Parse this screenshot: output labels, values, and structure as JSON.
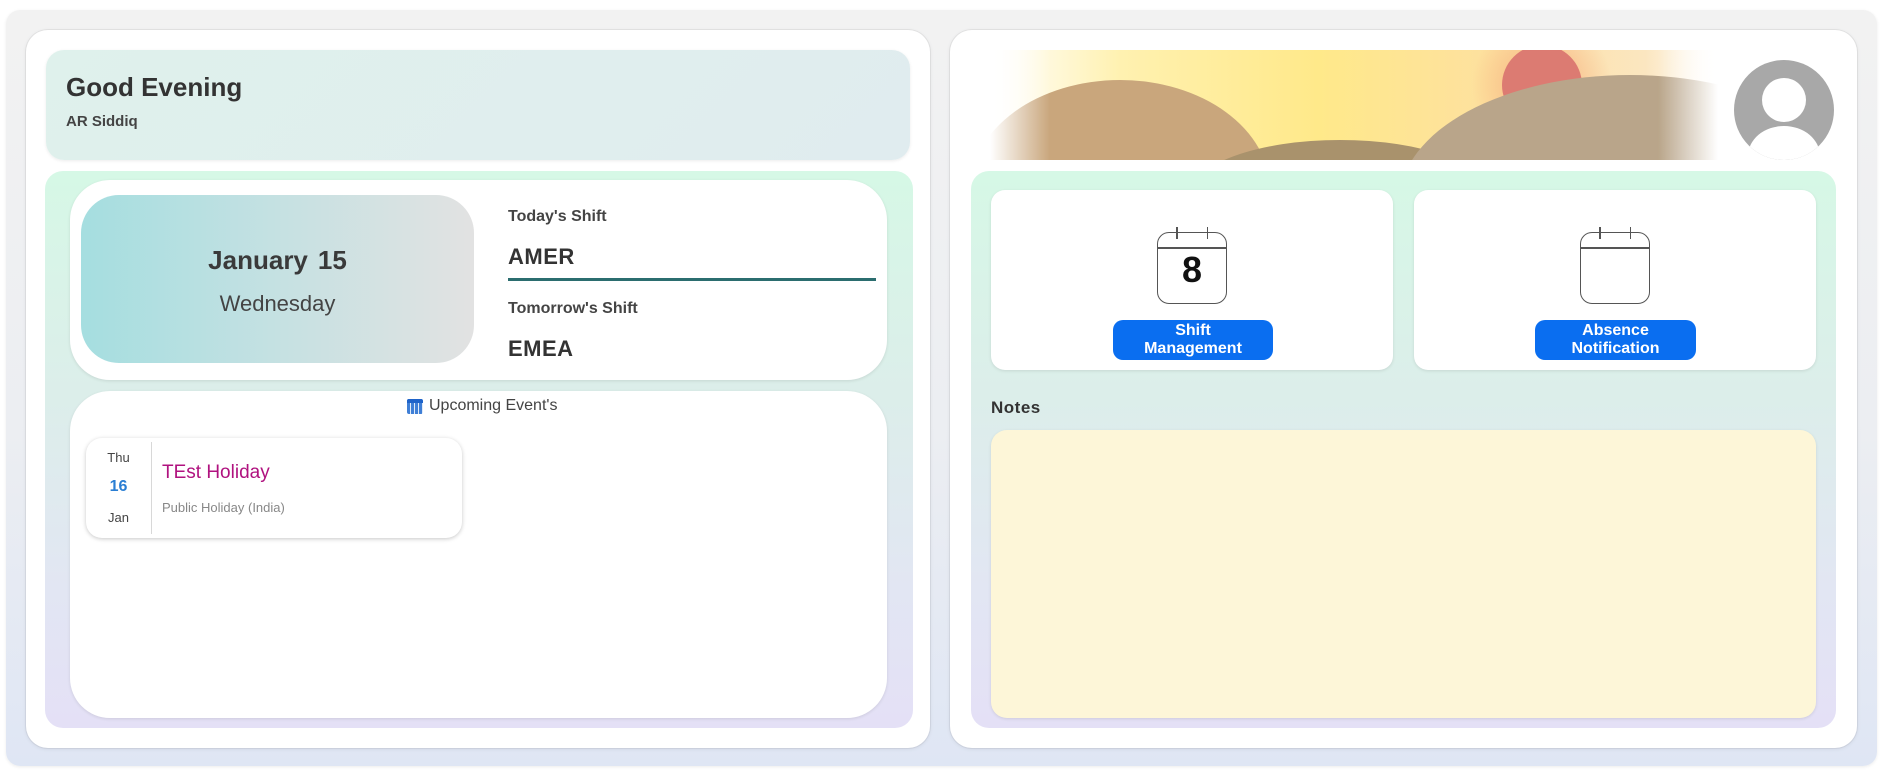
{
  "greeting": {
    "title": "Good Evening",
    "user": "AR Siddiq"
  },
  "today": {
    "month": "January",
    "day": "15",
    "weekday": "Wednesday"
  },
  "shifts": {
    "today_label": "Today's Shift",
    "today_value": "AMER",
    "tomorrow_label": "Tomorrow's Shift",
    "tomorrow_value": "EMEA"
  },
  "events": {
    "title": "Upcoming Event's",
    "icon": "calendar-icon",
    "items": [
      {
        "dow": "Thu",
        "day": "16",
        "month": "Jan",
        "name": "TEst Holiday",
        "type": "Public Holiday (India)"
      }
    ]
  },
  "quick_actions": {
    "shift_management": {
      "icon_number": "8",
      "label": "Shift Management"
    },
    "absence_notification": {
      "label": "Absence Notification"
    }
  },
  "notes": {
    "label": "Notes",
    "value": ""
  },
  "colors": {
    "primary_button": "#0a6ef0",
    "event_name": "#b0127f",
    "event_day": "#2a7ed3",
    "notes_bg": "#fdf6d8",
    "shift_underline": "#2b6d6f"
  }
}
